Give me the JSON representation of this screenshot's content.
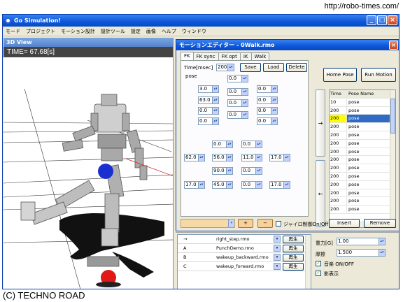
{
  "page": {
    "url": "http://robo-times.com/",
    "credit": "(C) TECHNO ROAD"
  },
  "app": {
    "title": "Go Simulation!",
    "menu": [
      "モード",
      "プロジェクト",
      "モーション設計",
      "設計ツール",
      "設定",
      "画像",
      "ヘルプ",
      "ウィンドウ"
    ]
  },
  "view3d": {
    "title": "3D View",
    "time_label": "TIME= 67.68[s]"
  },
  "editor": {
    "title": "モーションエディター - 0Walk.rmo",
    "tabs": [
      "FK",
      "FK sync",
      "FK opt",
      "IK",
      "Walk"
    ],
    "time_label": "Time[msec]",
    "time_value": "200",
    "pose_label": "pose",
    "save_label": "Save",
    "load_label": "Load",
    "delete_label": "Delete",
    "home_pose_label": "Home Pose",
    "run_motion_label": "Run Motion",
    "insert_label": "Insert",
    "remove_label": "Remove",
    "plus_label": "+",
    "minus_label": "−",
    "gyro_label": "ジャイロ制御On/Off",
    "arrow_right": "→",
    "arrow_left": "←",
    "joints": {
      "j_top": "0.0",
      "j_l1": "3.0",
      "j_l2": "63.0",
      "j_l3": "0.0",
      "j_l4": "0.0",
      "j_m1": "0.0",
      "j_m2": "0.0",
      "j_m3": "0.0",
      "j_r1": "0.0",
      "j_r2": "0.0",
      "j_r3": "0.0",
      "j_r4": "0.0",
      "j_a1": "0.0",
      "j_a2": "0.0",
      "j_b1": "62.0",
      "j_b2": "56.0",
      "j_b3": "11.0",
      "j_b4": "17.0",
      "j_c1": "90.0",
      "j_c2": "0.0",
      "j_d1": "17.0",
      "j_d2": "45.0",
      "j_d3": "0.0",
      "j_d4": "17.0"
    },
    "pose_table": {
      "headers": [
        "Time",
        "Pose Name"
      ],
      "rows": [
        {
          "time": "10",
          "name": "pose"
        },
        {
          "time": "200",
          "name": "pose"
        },
        {
          "time": "200",
          "name": "pose"
        },
        {
          "time": "200",
          "name": "pose"
        },
        {
          "time": "200",
          "name": "pose"
        },
        {
          "time": "200",
          "name": "pose"
        },
        {
          "time": "200",
          "name": "pose"
        },
        {
          "time": "200",
          "name": "pose"
        },
        {
          "time": "200",
          "name": "pose"
        },
        {
          "time": "200",
          "name": "pose"
        },
        {
          "time": "200",
          "name": "pose"
        },
        {
          "time": "200",
          "name": "pose"
        },
        {
          "time": "200",
          "name": "pose"
        },
        {
          "time": "200",
          "name": "pose"
        }
      ]
    }
  },
  "bottom": {
    "files": [
      {
        "key": "→",
        "file": "right_step.rmo",
        "play": "再生"
      },
      {
        "key": "A",
        "file": "PunchDemo.rmo",
        "play": "再生"
      },
      {
        "key": "B",
        "file": "wakeup_backward.rmo",
        "play": "再生"
      },
      {
        "key": "C",
        "file": "wakeup_forward.rmo",
        "play": "再生"
      }
    ],
    "gravity_label": "重力[G]",
    "gravity_value": "1.00",
    "friction_label": "摩擦",
    "friction_value": "1.500",
    "music_label": "音楽 ON/OFF",
    "shadow_label": "影表示"
  }
}
